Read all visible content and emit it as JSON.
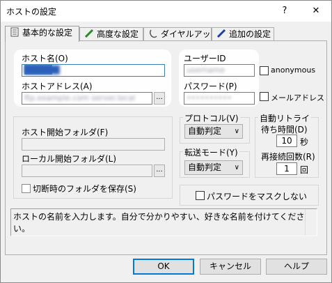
{
  "window": {
    "title": "ホストの設定",
    "help_icon": "?",
    "close_icon": "✕"
  },
  "tabs": [
    {
      "label": "基本的な設定",
      "icon": "page-icon"
    },
    {
      "label": "高度な設定",
      "icon": "pencil-green-icon"
    },
    {
      "label": "ダイヤルアップ",
      "icon": "phone-icon"
    },
    {
      "label": "追加の設定",
      "icon": "pen-blue-icon"
    }
  ],
  "fields": {
    "host_name_label": "ホスト名(O)",
    "host_name_value": "██████",
    "host_address_label": "ホストアドレス(A)",
    "host_address_value": "ftp.example.com server.local",
    "user_id_label": "ユーザーID",
    "user_id_value": "username",
    "password_label": "パスワード(P)",
    "password_value": "••••••••••",
    "anonymous_label": "anonymous",
    "mail_label": "メールアドレス",
    "host_folder_label": "ホスト開始フォルダ(F)",
    "local_folder_label": "ローカル開始フォルダ(L)",
    "save_folder_label": "切断時のフォルダを保存(S)",
    "dots_label": "..."
  },
  "protocol": {
    "label": "プロトコル(V)",
    "value": "自動判定"
  },
  "transfer": {
    "label": "転送モード(Y)",
    "value": "自動判定"
  },
  "retry": {
    "label": "自動リトライ",
    "wait_label": "待ち時間(D)",
    "wait_value": "10",
    "wait_unit": "秒",
    "count_label": "再接続回数(R)",
    "count_value": "1",
    "count_unit": "回"
  },
  "mask_password_label": "パスワードをマスクしない",
  "hint_text": "ホストの名前を入力します。自分で分かりやすい、好きな名前を付けてください。",
  "buttons": {
    "ok": "OK",
    "cancel": "キャンセル",
    "help": "ヘルプ"
  }
}
